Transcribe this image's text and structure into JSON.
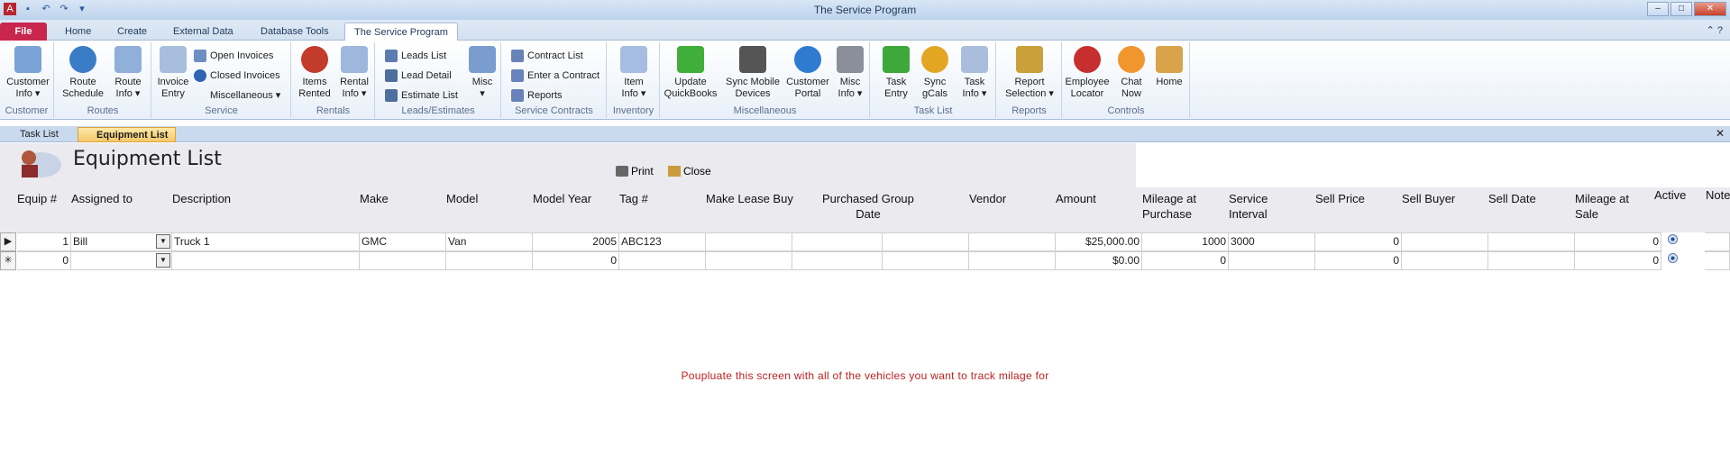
{
  "window": {
    "title": "The Service Program"
  },
  "ribbon_tabs": [
    "File",
    "Home",
    "Create",
    "External Data",
    "Database Tools",
    "The Service Program"
  ],
  "groups": {
    "customer": {
      "label": "Customer",
      "btn": "Customer\nInfo ▾"
    },
    "routes": {
      "label": "Routes",
      "btn1": "Route\nSchedule",
      "btn2": "Route\nInfo ▾"
    },
    "service": {
      "label": "Service",
      "btn": "Invoice\nEntry",
      "s1": "Open Invoices",
      "s2": "Closed Invoices",
      "s3": "Miscellaneous ▾"
    },
    "rentals": {
      "label": "Rentals",
      "btn1": "Items\nRented",
      "btn2": "Rental\nInfo ▾"
    },
    "leads": {
      "label": "Leads/Estimates",
      "s1": "Leads List",
      "s2": "Lead Detail",
      "s3": "Estimate List",
      "btn": "Misc\n▾"
    },
    "contracts": {
      "label": "Service Contracts",
      "s1": "Contract List",
      "s2": "Enter a Contract",
      "s3": "Reports"
    },
    "inventory": {
      "label": "Inventory",
      "btn": "Item\nInfo ▾"
    },
    "misc": {
      "label": "Miscellaneous",
      "btn1": "Update\nQuickBooks",
      "btn2": "Sync Mobile\nDevices",
      "btn3": "Customer\nPortal",
      "btn4": "Misc\nInfo ▾"
    },
    "tasklist": {
      "label": "Task List",
      "btn1": "Task\nEntry",
      "btn2": "Sync\ngCals",
      "btn3": "Task\nInfo ▾"
    },
    "reports": {
      "label": "Reports",
      "btn": "Report\nSelection ▾"
    },
    "controls": {
      "label": "Controls",
      "btn1": "Employee\nLocator",
      "btn2": "Chat\nNow",
      "btn3": "Home"
    }
  },
  "doc_tabs": [
    "Task List",
    "Equipment List"
  ],
  "form": {
    "title": "Equipment List",
    "print": "Print",
    "close": "Close"
  },
  "columns": [
    "Equip #",
    "Assigned to",
    "Description",
    "Make",
    "Model",
    "Model Year",
    "Tag #",
    "Make Lease Buy",
    "Purchased Group\nDate",
    "Vendor",
    "Amount",
    "Mileage at\nPurchase",
    "Service\nInterval",
    "Sell Price",
    "Sell Buyer",
    "Sell Date",
    "Mileage at\nSale",
    "Active",
    "Note"
  ],
  "rows": [
    {
      "selector": "▶",
      "equip": "1",
      "assigned": "Bill",
      "desc": "Truck 1",
      "make": "GMC",
      "model": "Van",
      "year": "2005",
      "tag": "ABC123",
      "lease": "",
      "pgroup": "",
      "date": "",
      "vendor": "",
      "amount": "$25,000.00",
      "mileage_p": "1000",
      "interval": "3000",
      "sell_price": "0",
      "sell_buyer": "",
      "sell_date": "",
      "mileage_s": "0"
    },
    {
      "selector": "✳",
      "equip": "0",
      "assigned": "",
      "desc": "",
      "make": "",
      "model": "",
      "year": "0",
      "tag": "",
      "lease": "",
      "pgroup": "",
      "date": "",
      "vendor": "",
      "amount": "$0.00",
      "mileage_p": "0",
      "interval": "",
      "sell_price": "0",
      "sell_buyer": "",
      "sell_date": "",
      "mileage_s": "0"
    }
  ],
  "note": "Poupluate this screen with all of the vehicles you want to track milage for"
}
